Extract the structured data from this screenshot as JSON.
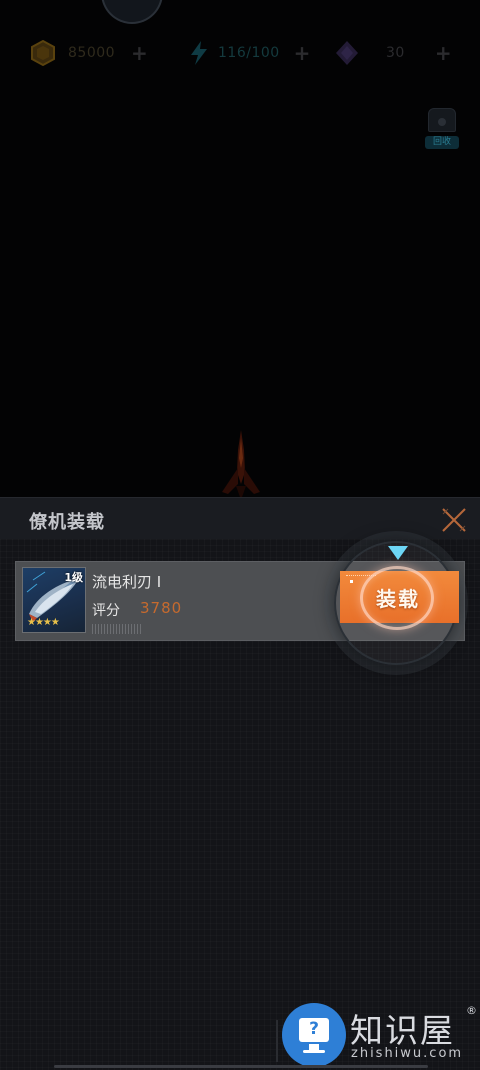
{
  "resources": {
    "gold": {
      "value": "85000",
      "plus": "+",
      "icon": "gold-coin-icon"
    },
    "energy": {
      "value": "116/100",
      "plus": "+",
      "icon": "lightning-icon"
    },
    "gems": {
      "value": "30",
      "plus": "+",
      "icon": "purple-crystal-icon"
    }
  },
  "side_buttons": {
    "recycle_label": "回收"
  },
  "panel": {
    "title": "僚机装载",
    "close_icon": "close-x-icon"
  },
  "item": {
    "level": "1级",
    "name": "流电利刃 I",
    "score_label": "评分",
    "score_value": "3780",
    "stars": "★★★★",
    "star_count": 4
  },
  "equip": {
    "label": "装载"
  },
  "watermark": {
    "title": "知识屋",
    "registered": "®",
    "domain": "zhishiwu.com"
  },
  "colors": {
    "accent": "#e8702a",
    "score": "#c66a2e",
    "panel_bg": "#131418",
    "pointer": "#6dd6f5",
    "watermark_blue": "#2e7fd6"
  }
}
